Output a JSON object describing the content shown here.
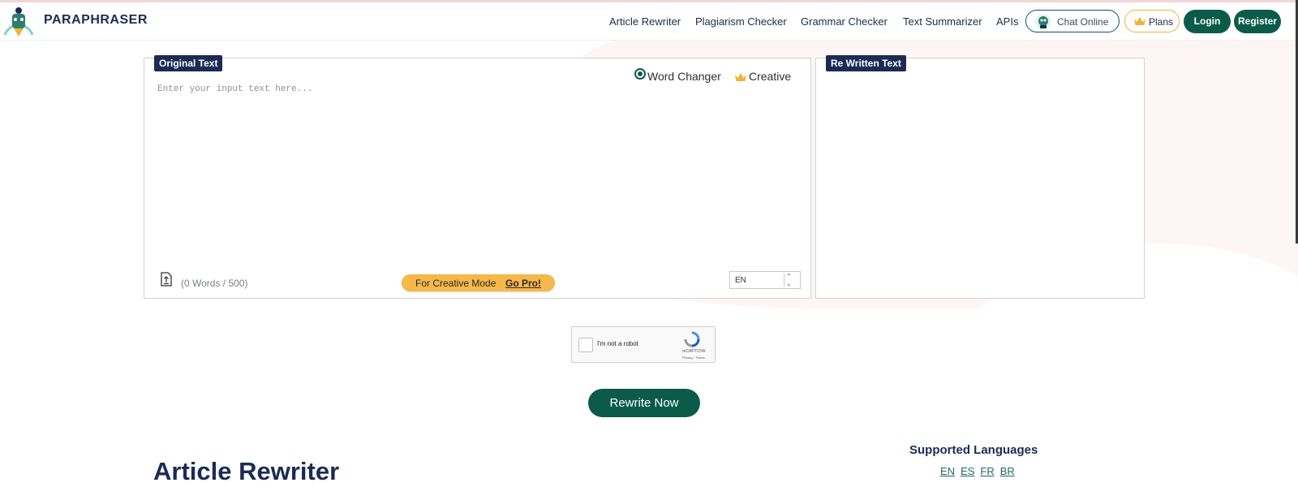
{
  "header": {
    "brand": "PARAPHRASER",
    "nav": [
      "Article Rewriter",
      "Plagiarism Checker",
      "Grammar Checker",
      "Text Summarizer",
      "APIs"
    ],
    "chat_label": "Chat Online",
    "plans_label": "Plans",
    "login_label": "Login",
    "register_label": "Register"
  },
  "left_panel": {
    "tag": "Original Text",
    "placeholder": "Enter your input text here...",
    "mode_word_changer": "Word Changer",
    "mode_creative": "Creative",
    "word_count": "(0 Words / 500)",
    "go_pro_text": "For Creative Mode",
    "go_pro_link": "Go Pro!",
    "language": "EN"
  },
  "right_panel": {
    "tag": "Re Written Text"
  },
  "captcha": {
    "label": "I'm not a robot",
    "brand": "reCAPTCHA",
    "terms": "Privacy - Terms"
  },
  "rewrite_label": "Rewrite Now",
  "article_title": "Article Rewriter",
  "supported_languages": {
    "title": "Supported Languages",
    "items": [
      "EN",
      "ES",
      "FR",
      "BR"
    ]
  },
  "colors": {
    "accent_green": "#0c5b4a",
    "navy": "#1c2b55",
    "gold": "#f6b849"
  }
}
